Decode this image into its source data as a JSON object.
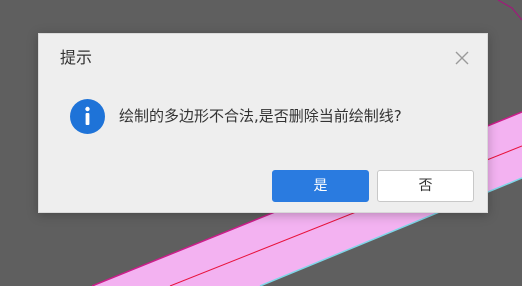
{
  "dialog": {
    "title": "提示",
    "close_icon": "close-icon",
    "message_icon": "info-icon",
    "message": "绘制的多边形不合法,是否删除当前绘制线?",
    "yes_label": "是",
    "no_label": "否"
  },
  "colors": {
    "canvas_background": "#5f5f5f",
    "polygon_fill": "#f3b2f1",
    "polygon_edge": "#cc1d8a",
    "draw_line": "#e8123c",
    "accent": "#2a7be0"
  }
}
